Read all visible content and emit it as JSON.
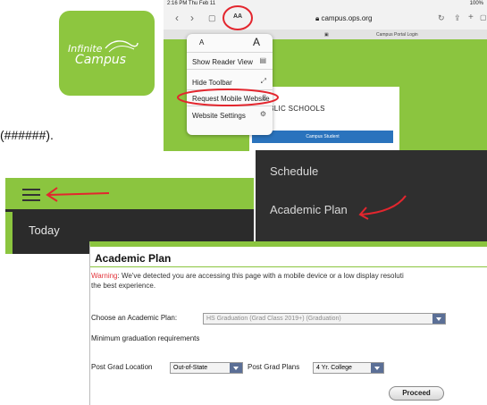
{
  "logo": {
    "line1": "Infinite",
    "line2": "Campus"
  },
  "placeholder_text": "(######).",
  "ipad": {
    "status_time": "2:16 PM  Thu Feb 11",
    "status_right": "100%",
    "aa_label": "AA",
    "url": "campus.ops.org",
    "tab_center": "Campus Portal Login",
    "card_title": "UBLIC SCHOOLS",
    "card_button": "Campus Student",
    "menu": {
      "font_small": "A",
      "font_large": "A",
      "reader": "Show Reader View",
      "hide_toolbar": "Hide Toolbar",
      "request_mobile": "Request Mobile Website",
      "website_settings": "Website Settings"
    },
    "annotation_color": "#e3262e"
  },
  "toolbar_panel": {
    "today_label": "Today"
  },
  "dark_menu": {
    "items": [
      "Schedule",
      "Academic Plan"
    ]
  },
  "academic_plan": {
    "title": "Academic Plan",
    "warning_label": "Warning",
    "warning_text": ": We've detected you are accessing this page with a mobile device or a low display resoluti",
    "warning_text2": "the best experience.",
    "choose_label": "Choose an Academic Plan:",
    "choose_value": "HS Graduation (Grad Class 2019+) (Graduation)",
    "min_req": "Minimum graduation requirements",
    "location_label": "Post Grad Location",
    "location_value": "Out-of-State",
    "plans_label": "Post Grad Plans",
    "plans_value": "4 Yr. College",
    "proceed": "Proceed"
  },
  "colors": {
    "brand_green": "#8bc53f",
    "dark": "#2f2f2f",
    "select_arrow": "#5b6f96",
    "warning": "#e2343b"
  }
}
